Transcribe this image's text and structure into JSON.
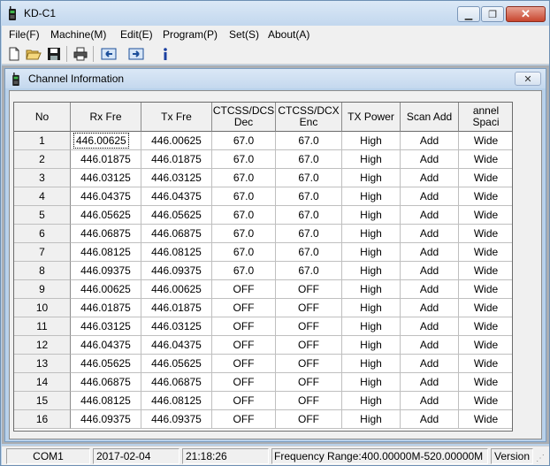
{
  "app": {
    "title": "KD-C1"
  },
  "menu": {
    "items": [
      "File(F)",
      "Machine(M)",
      "Edit(E)",
      "Program(P)",
      "Set(S)",
      "About(A)"
    ]
  },
  "toolbar": {
    "icons": [
      "new-file-icon",
      "open-folder-icon",
      "save-icon",
      "print-icon",
      "read-from-radio-icon",
      "write-to-radio-icon",
      "info-icon"
    ]
  },
  "child": {
    "title": "Channel Information"
  },
  "grid": {
    "columns": [
      "No",
      "Rx Fre",
      "Tx Fre",
      "CTCSS/DCS\nDec",
      "CTCSS/DCX\nEnc",
      "TX Power",
      "Scan Add",
      "annel Spaci"
    ],
    "rows": [
      [
        "1",
        "446.00625",
        "446.00625",
        "67.0",
        "67.0",
        "High",
        "Add",
        "Wide"
      ],
      [
        "2",
        "446.01875",
        "446.01875",
        "67.0",
        "67.0",
        "High",
        "Add",
        "Wide"
      ],
      [
        "3",
        "446.03125",
        "446.03125",
        "67.0",
        "67.0",
        "High",
        "Add",
        "Wide"
      ],
      [
        "4",
        "446.04375",
        "446.04375",
        "67.0",
        "67.0",
        "High",
        "Add",
        "Wide"
      ],
      [
        "5",
        "446.05625",
        "446.05625",
        "67.0",
        "67.0",
        "High",
        "Add",
        "Wide"
      ],
      [
        "6",
        "446.06875",
        "446.06875",
        "67.0",
        "67.0",
        "High",
        "Add",
        "Wide"
      ],
      [
        "7",
        "446.08125",
        "446.08125",
        "67.0",
        "67.0",
        "High",
        "Add",
        "Wide"
      ],
      [
        "8",
        "446.09375",
        "446.09375",
        "67.0",
        "67.0",
        "High",
        "Add",
        "Wide"
      ],
      [
        "9",
        "446.00625",
        "446.00625",
        "OFF",
        "OFF",
        "High",
        "Add",
        "Wide"
      ],
      [
        "10",
        "446.01875",
        "446.01875",
        "OFF",
        "OFF",
        "High",
        "Add",
        "Wide"
      ],
      [
        "11",
        "446.03125",
        "446.03125",
        "OFF",
        "OFF",
        "High",
        "Add",
        "Wide"
      ],
      [
        "12",
        "446.04375",
        "446.04375",
        "OFF",
        "OFF",
        "High",
        "Add",
        "Wide"
      ],
      [
        "13",
        "446.05625",
        "446.05625",
        "OFF",
        "OFF",
        "High",
        "Add",
        "Wide"
      ],
      [
        "14",
        "446.06875",
        "446.06875",
        "OFF",
        "OFF",
        "High",
        "Add",
        "Wide"
      ],
      [
        "15",
        "446.08125",
        "446.08125",
        "OFF",
        "OFF",
        "High",
        "Add",
        "Wide"
      ],
      [
        "16",
        "446.09375",
        "446.09375",
        "OFF",
        "OFF",
        "High",
        "Add",
        "Wide"
      ]
    ],
    "selected_row": 0,
    "selected_col": 1
  },
  "status": {
    "port": "COM1",
    "date": "2017-02-04",
    "time": "21:18:26",
    "frequency_range": "Frequency Range:400.00000M-520.00000M",
    "version": "Version"
  }
}
